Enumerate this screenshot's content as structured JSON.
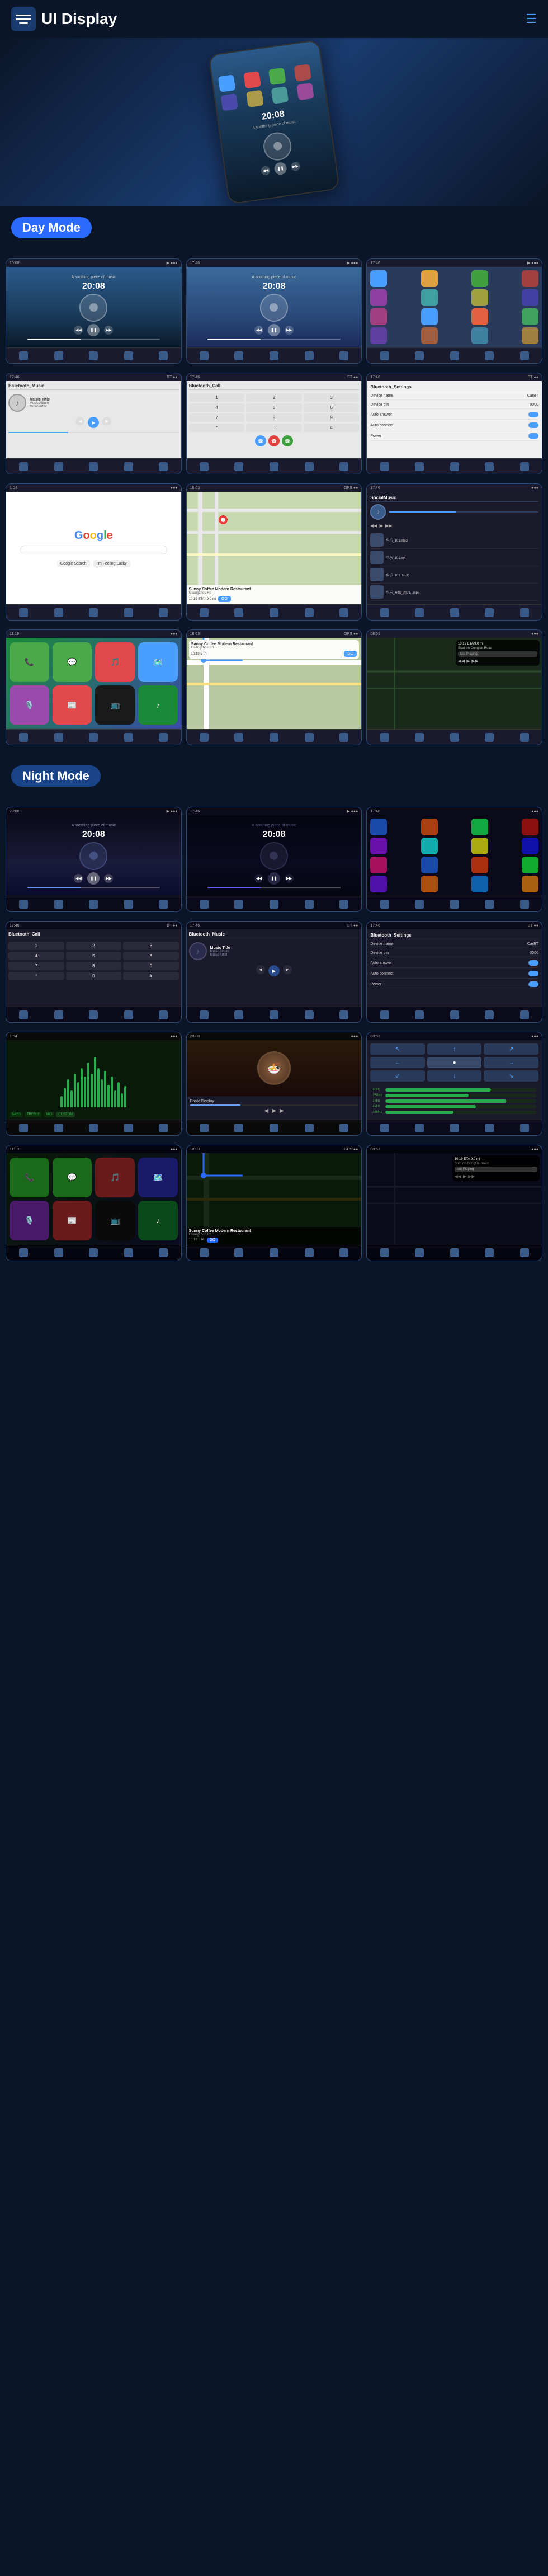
{
  "header": {
    "title": "UI Display",
    "menu_icon": "☰",
    "hamburger": "≡",
    "dots": "⋮"
  },
  "day_mode": {
    "label": "Day Mode"
  },
  "night_mode": {
    "label": "Night Mode"
  },
  "music": {
    "title": "Music Title",
    "album": "Music Album",
    "artist": "Music Artist",
    "time": "20:08"
  },
  "bluetooth": {
    "music_label": "Bluetooth_Music",
    "call_label": "Bluetooth_Call",
    "settings_label": "Bluetooth_Settings"
  },
  "settings": {
    "device_name_label": "Device name",
    "device_name_val": "CarBT",
    "device_pin_label": "Device pin",
    "device_pin_val": "0000",
    "auto_answer_label": "Auto answer",
    "auto_connect_label": "Auto connect",
    "power_label": "Power"
  },
  "nav": {
    "restaurant": "Sunny Coffee Modern Restaurant",
    "address": "Guangzhou Rd",
    "go_label": "GO",
    "eta": "10:19 ETA",
    "distance": "9.0 mi"
  },
  "social_music": {
    "label": "SocialMusic",
    "files": [
      "华乐_101.mp3",
      "华乐_101.m4",
      "华乐_101_REC",
      "华乐_开始_用93...mp3"
    ]
  },
  "google": {
    "brand": "Google"
  }
}
